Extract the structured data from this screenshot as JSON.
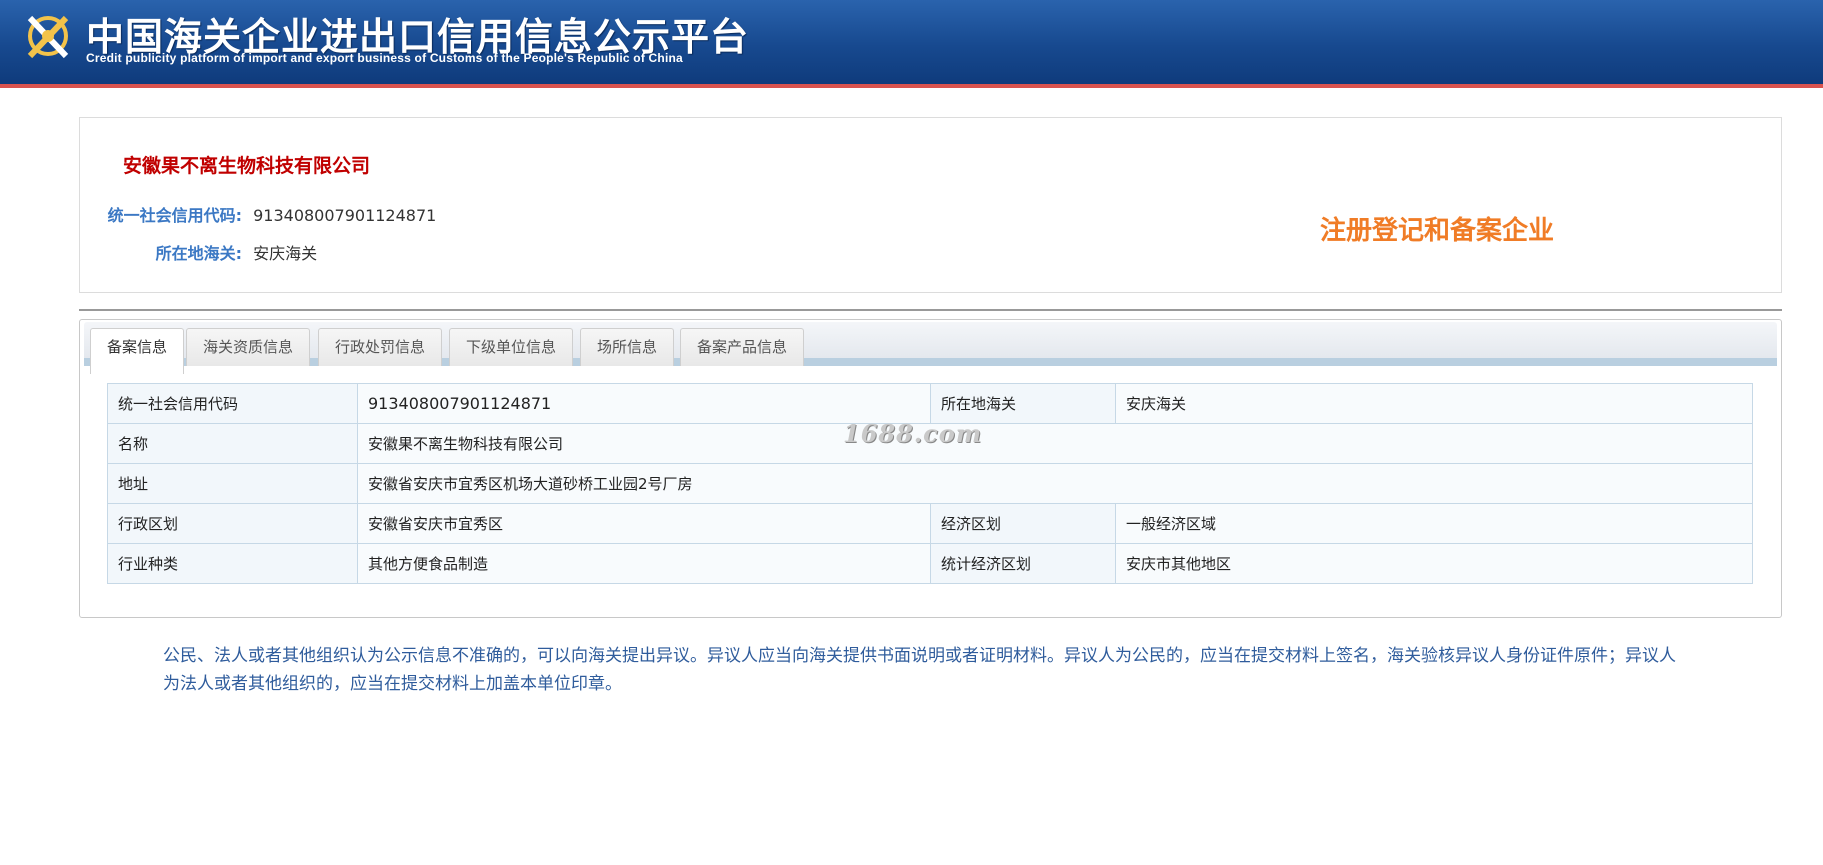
{
  "header": {
    "title_cn": "中国海关企业进出口信用信息公示平台",
    "title_en": "Credit publicity platform of import and export business of Customs of the People's Republic of China"
  },
  "company": {
    "name": "安徽果不离生物科技有限公司",
    "credit_code_label": "统一社会信用代码:",
    "credit_code": "913408007901124871",
    "customs_label": "所在地海关:",
    "customs": "安庆海关",
    "stamp": "注册登记和备案企业"
  },
  "tabs": [
    {
      "label": "备案信息",
      "active": true
    },
    {
      "label": "海关资质信息",
      "active": false
    },
    {
      "label": "行政处罚信息",
      "active": false
    },
    {
      "label": "下级单位信息",
      "active": false
    },
    {
      "label": "场所信息",
      "active": false
    },
    {
      "label": "备案产品信息",
      "active": false
    }
  ],
  "detail": {
    "code_label": "统一社会信用代码",
    "code": "913408007901124871",
    "customs_label": "所在地海关",
    "customs": "安庆海关",
    "name_label": "名称",
    "name": "安徽果不离生物科技有限公司",
    "address_label": "地址",
    "address": "安徽省安庆市宜秀区机场大道砂桥工业园2号厂房",
    "admin_region_label": "行政区划",
    "admin_region": "安徽省安庆市宜秀区",
    "econ_region_label": "经济区划",
    "econ_region": "一般经济区域",
    "industry_label": "行业种类",
    "industry": "其他方便食品制造",
    "stat_region_label": "统计经济区划",
    "stat_region": "安庆市其他地区"
  },
  "watermark": "1688.com",
  "notice": "公民、法人或者其他组织认为公示信息不准确的，可以向海关提出异议。异议人应当向海关提供书面说明或者证明材料。异议人为公民的，应当在提交材料上签名，海关验核异议人身份证件原件；异议人为法人或者其他组织的，应当在提交材料上加盖本单位印章。",
  "colors": {
    "header_blue": "#17498f",
    "company_red": "#c00000",
    "label_blue": "#3b78c4",
    "stamp_orange": "#f07c26",
    "notice_blue": "#2f5c9c"
  }
}
